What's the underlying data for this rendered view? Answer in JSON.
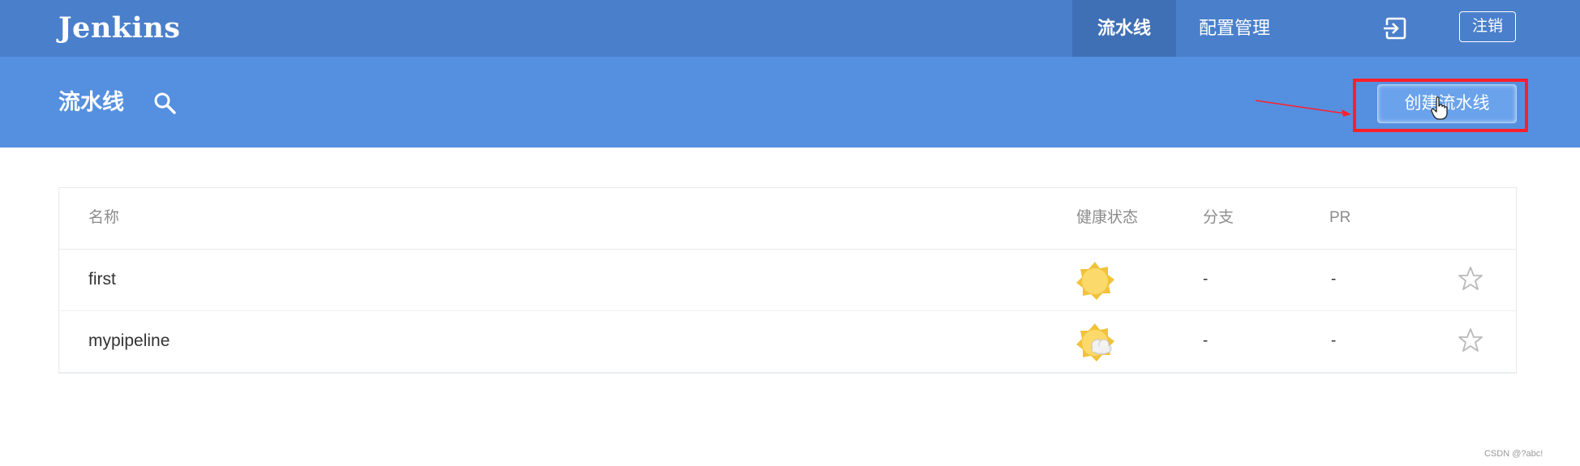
{
  "header": {
    "brand": "Jenkins",
    "tabs": [
      {
        "label": "流水线",
        "active": true
      },
      {
        "label": "配置管理",
        "active": false
      }
    ],
    "exit_icon": "exit-icon",
    "logout_label": "注销",
    "bar_color": "#4a7fcb"
  },
  "subheader": {
    "title": "流水线",
    "search_icon": "search-icon",
    "create_label": "创建流水线",
    "bar_color": "#5590e0",
    "annotation_color": "#ff1f2a"
  },
  "table": {
    "columns": [
      "名称",
      "健康状态",
      "分支",
      "PR"
    ],
    "rows": [
      {
        "name": "first",
        "health_icon": "sunny-icon",
        "branches": "-",
        "pr": "-",
        "favorite_icon": "star-icon"
      },
      {
        "name": "mypipeline",
        "health_icon": "partly-cloudy-icon",
        "branches": "-",
        "pr": "-",
        "favorite_icon": "star-icon"
      }
    ]
  },
  "footer": {
    "watermark": "CSDN @?abc!"
  }
}
